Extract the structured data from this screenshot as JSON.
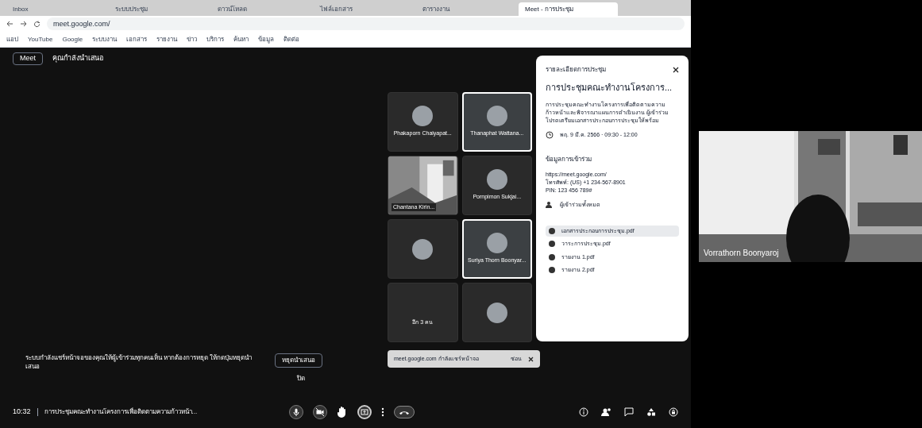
{
  "browser": {
    "tabs": [
      {
        "title": "Inbox",
        "selected": false
      },
      {
        "title": "ระบบประชุม",
        "selected": false
      },
      {
        "title": "ดาวน์โหลด",
        "selected": false
      },
      {
        "title": "ไฟล์เอกสาร",
        "selected": false
      },
      {
        "title": "ตารางงาน",
        "selected": false
      },
      {
        "title": "Meet - การประชุม",
        "selected": true
      }
    ],
    "address": "meet.google.com/",
    "bookmarks": [
      "แอป",
      "YouTube",
      "Google",
      "ระบบงาน",
      "เอกสาร",
      "รายงาน",
      "ข่าว",
      "บริการ",
      "ค้นหา",
      "ข้อมูล",
      "ติดต่อ"
    ]
  },
  "meet": {
    "top_bar": {
      "chip": "Meet",
      "title": "คุณกำลังนำเสนอ"
    },
    "notice": {
      "text": "ระบบกำลังแชร์หน้าจอของคุณให้ผู้เข้าร่วมทุกคนเห็น หากต้องการหยุด ให้กดปุ่มหยุดนำเสนอ",
      "button": "หยุดนำเสนอ",
      "dismiss": "ปิด"
    },
    "tiles": [
      {
        "name": "Phakaporn Chaiyapat...",
        "kind": "avatar",
        "speaking": false
      },
      {
        "name": "Thanaphat Wattana...",
        "kind": "avatar",
        "speaking": true
      },
      {
        "name": "Chantana Kirin...",
        "kind": "camera",
        "speaking": false
      },
      {
        "name": "Pornpimon Sukjai...",
        "kind": "avatar",
        "speaking": false
      },
      {
        "kind": "avatar",
        "speaking": false
      },
      {
        "name": "Suriya Thorn Boonyar...",
        "kind": "avatar",
        "speaking": true
      },
      {
        "name": "อีก 3 คน",
        "kind": "more",
        "speaking": false
      },
      {
        "kind": "avatar",
        "speaking": false
      }
    ],
    "toast": {
      "text": "meet.google.com กำลังแชร์หน้าจอ",
      "button": "ซ่อน"
    },
    "details": {
      "heading": "รายละเอียดการประชุม",
      "title": "การประชุมคณะทำงานโครงการ...",
      "description": "การประชุมคณะทำงานโครงการเพื่อติดตามความก้าวหน้าและพิจารณาแผนการดำเนินงาน ผู้เข้าร่วมโปรดเตรียมเอกสารประกอบการประชุมให้พร้อม",
      "time": "พฤ. 9 มี.ค. 2566 · 09:30 - 12:00",
      "joining_heading": "ข้อมูลการเข้าร่วม",
      "joining_lines": [
        "https://meet.google.com/",
        "โทรศัพท์: (US) +1 234-567-8901",
        "PIN: 123 456 789#"
      ],
      "guests": "ผู้เข้าร่วมทั้งหมด",
      "attachments": [
        {
          "name": "เอกสารประกอบการประชุม.pdf",
          "selected": true
        },
        {
          "name": "วาระการประชุม.pdf",
          "selected": false
        },
        {
          "name": "รายงาน 1.pdf",
          "selected": false
        },
        {
          "name": "รายงาน 2.pdf",
          "selected": false
        }
      ]
    },
    "bottom": {
      "time": "10:32",
      "title": "การประชุมคณะทำงานโครงการเพื่อติดตามความก้าวหน้า..."
    }
  },
  "side_video": {
    "name": "Vorrathorn Boonyaroj"
  }
}
